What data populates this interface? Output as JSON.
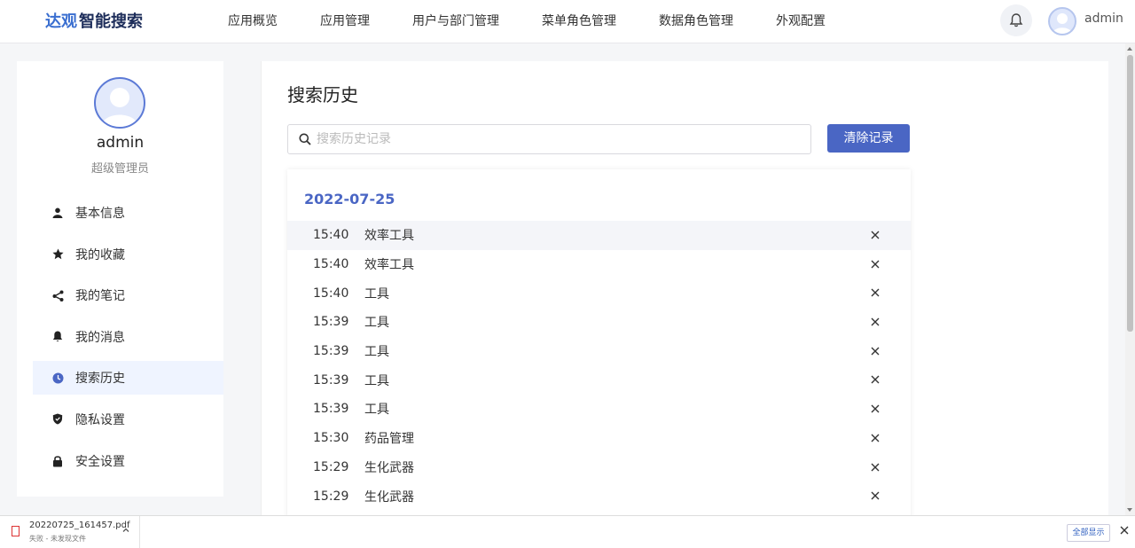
{
  "app": {
    "logo_mark": "达观",
    "logo_text": "智能搜索"
  },
  "nav": {
    "items": [
      {
        "label": "应用概览"
      },
      {
        "label": "应用管理"
      },
      {
        "label": "用户与部门管理"
      },
      {
        "label": "菜单角色管理"
      },
      {
        "label": "数据角色管理"
      },
      {
        "label": "外观配置"
      }
    ],
    "bell_icon": "bell-icon",
    "user": "admin"
  },
  "profile": {
    "name": "admin",
    "role": "超级管理员"
  },
  "menu": {
    "items": [
      {
        "label": "基本信息",
        "icon": "user-icon"
      },
      {
        "label": "我的收藏",
        "icon": "star-icon"
      },
      {
        "label": "我的笔记",
        "icon": "share-icon"
      },
      {
        "label": "我的消息",
        "icon": "bell-icon"
      },
      {
        "label": "搜索历史",
        "icon": "clock-icon",
        "active": true
      },
      {
        "label": "隐私设置",
        "icon": "shield-icon"
      },
      {
        "label": "安全设置",
        "icon": "lock-icon"
      }
    ]
  },
  "main": {
    "title": "搜索历史",
    "search_placeholder": "搜索历史记录",
    "clear_label": "清除记录",
    "date": "2022-07-25",
    "history": [
      {
        "time": "15:40",
        "query": "效率工具"
      },
      {
        "time": "15:40",
        "query": "效率工具"
      },
      {
        "time": "15:40",
        "query": "工具"
      },
      {
        "time": "15:39",
        "query": "工具"
      },
      {
        "time": "15:39",
        "query": "工具"
      },
      {
        "time": "15:39",
        "query": "工具"
      },
      {
        "time": "15:39",
        "query": "工具"
      },
      {
        "time": "15:30",
        "query": "药品管理"
      },
      {
        "time": "15:29",
        "query": "生化武器"
      },
      {
        "time": "15:29",
        "query": "生化武器"
      }
    ]
  },
  "download": {
    "filename": "20220725_161457.pdf",
    "status": "失败 - 未发现文件",
    "show_all": "全部显示"
  },
  "colors": {
    "accent": "#4a66c4",
    "active_menu_bg": "#eff4ff"
  }
}
